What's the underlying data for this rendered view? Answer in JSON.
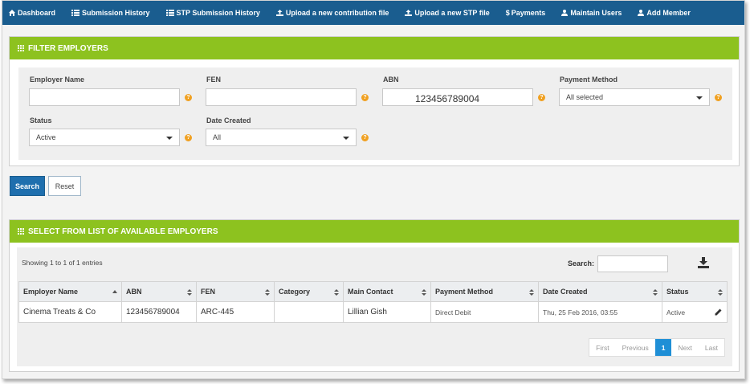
{
  "nav": {
    "items": [
      {
        "label": "Dashboard",
        "icon": "home-icon"
      },
      {
        "label": "Submission History",
        "icon": "list-icon"
      },
      {
        "label": "STP Submission History",
        "icon": "list-icon"
      },
      {
        "label": "Upload a new contribution file",
        "icon": "upload-icon"
      },
      {
        "label": "Upload a new STP file",
        "icon": "upload-icon"
      },
      {
        "label": "Payments",
        "icon": "dollar-icon"
      },
      {
        "label": "Maintain Users",
        "icon": "user-icon"
      },
      {
        "label": "Add Member",
        "icon": "user-icon"
      }
    ]
  },
  "filter": {
    "title": "FILTER EMPLOYERS",
    "employer_name_label": "Employer Name",
    "employer_name_value": "",
    "fen_label": "FEN",
    "fen_value": "",
    "abn_label": "ABN",
    "abn_value": "123456789004",
    "payment_method_label": "Payment Method",
    "payment_method_value": "All selected",
    "status_label": "Status",
    "status_value": "Active",
    "date_created_label": "Date Created",
    "date_created_value": "All",
    "help_glyph": "?"
  },
  "actions": {
    "search_label": "Search",
    "reset_label": "Reset"
  },
  "list": {
    "title": "SELECT FROM LIST OF AVAILABLE EMPLOYERS",
    "showing": "Showing 1 to 1 of 1 entries",
    "search_label": "Search:",
    "search_value": "",
    "columns": [
      "Employer Name",
      "ABN",
      "FEN",
      "Category",
      "Main Contact",
      "Payment Method",
      "Date Created",
      "Status"
    ],
    "rows": [
      {
        "employer_name": "Cinema Treats & Co",
        "abn": "123456789004",
        "fen": "ARC-445",
        "category": "",
        "main_contact": "Lillian Gish",
        "payment_method": "Direct Debit",
        "date_created": "Thu, 25 Feb 2016, 03:55",
        "status": "Active"
      }
    ],
    "pagination": {
      "first": "First",
      "previous": "Previous",
      "current": "1",
      "next": "Next",
      "last": "Last"
    }
  },
  "colors": {
    "nav_bg": "#1a5d8f",
    "panel_header": "#8dc21f",
    "primary": "#1f6fae",
    "help": "#f0a020"
  }
}
